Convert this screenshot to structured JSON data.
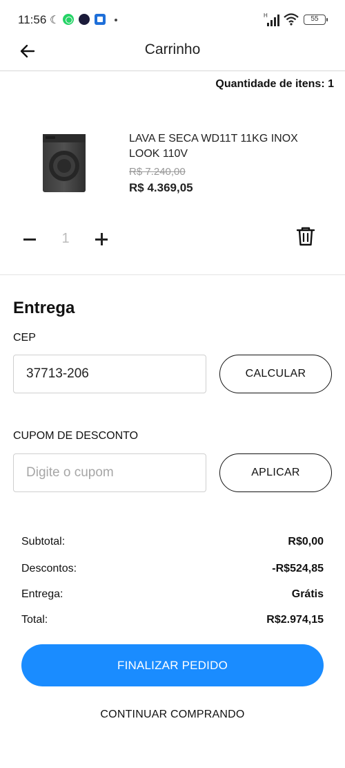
{
  "status_bar": {
    "time": "11:56",
    "network": "H",
    "battery": "55",
    "icons": [
      "moon-icon",
      "whatsapp-icon",
      "app-icon",
      "outlook-icon",
      "more-dot-icon",
      "signal-icon",
      "wifi-icon",
      "battery-icon"
    ]
  },
  "header": {
    "title": "Carrinho",
    "back_icon": "arrow-left-icon"
  },
  "cart": {
    "quantity_label": "Quantidade de itens: 1"
  },
  "product": {
    "name": "LAVA E SECA WD11T 11KG INOX LOOK 110V",
    "old_price": "R$ 7.240,00",
    "price": "R$ 4.369,05",
    "quantity": "1",
    "image_icon": "washer-dryer-image"
  },
  "delivery": {
    "title": "Entrega",
    "cep_label": "CEP",
    "cep_value": "37713-206",
    "calculate_label": "CALCULAR"
  },
  "coupon": {
    "label": "CUPOM DE DESCONTO",
    "placeholder": "Digite o cupom",
    "apply_label": "APLICAR"
  },
  "totals": {
    "subtotal_label": "Subtotal:",
    "subtotal_value": "R$0,00",
    "discount_label": "Descontos:",
    "discount_value": "-R$524,85",
    "delivery_label": "Entrega:",
    "delivery_value": "Grátis",
    "total_label": "Total:",
    "total_value": "R$2.974,15"
  },
  "actions": {
    "finalize_label": "FINALIZAR PEDIDO",
    "continue_label": "CONTINUAR COMPRANDO"
  },
  "colors": {
    "primary": "#1a8cff",
    "text": "#111111",
    "muted": "#999999",
    "border": "#cfcfcf"
  }
}
